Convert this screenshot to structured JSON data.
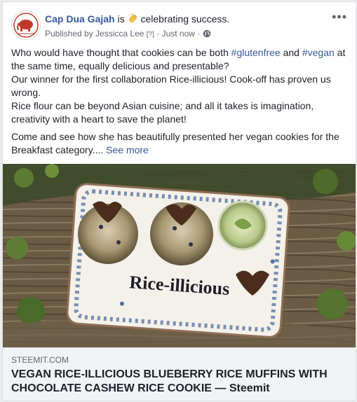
{
  "post": {
    "page_name": "Cap Dua Gajah",
    "is_text": " is ",
    "activity": "celebrating success.",
    "activity_icon": "clapping-hands-icon",
    "published_by": "Published by Jessicca Lee",
    "help_marker": "[?]",
    "separator": "·",
    "time": "Just now",
    "privacy_icon": "globe-icon",
    "menu_label": "•••",
    "text": {
      "p1_a": "Who would have thought that cookies can be both ",
      "tag1": "#glutenfree",
      "p1_b": " and ",
      "tag2": "#vegan",
      "p1_c": " at the same time, equally delicious and presentable?",
      "p1_d": "Our winner for the first collaboration Rice-illicious! Cook-off has proven us wrong.",
      "p1_e": "Rice flour can be beyond Asian cuisine; and all it takes is imagination, creativity with a heart to save the planet!",
      "p2": "Come and see how she has beautifully presented her vegan cookies for the Breakfast category.... ",
      "see_more": "See more"
    },
    "image": {
      "plate_text": "Rice-illicious"
    },
    "link": {
      "domain": "STEEMIT.COM",
      "title": "VEGAN RICE-ILLICIOUS BLUEBERRY RICE MUFFINS WITH CHOCOLATE CASHEW RICE COOKIE — Steemit"
    }
  }
}
